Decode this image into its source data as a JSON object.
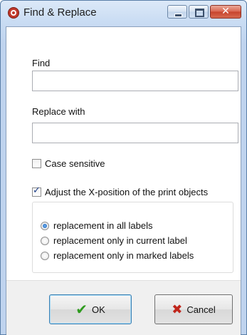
{
  "window": {
    "title": "Find & Replace",
    "close_glyph": "✕"
  },
  "find": {
    "label": "Find",
    "value": "",
    "placeholder": ""
  },
  "replace": {
    "label": "Replace with",
    "value": "",
    "placeholder": ""
  },
  "options": {
    "case_sensitive": {
      "label": "Case sensitive",
      "checked": false
    },
    "adjust_x": {
      "label": "Adjust the X-position of the print objects",
      "checked": true
    }
  },
  "scope": {
    "selected": "all",
    "items": [
      {
        "id": "all",
        "label": "replacement in all labels"
      },
      {
        "id": "current",
        "label": "replacement only in current label"
      },
      {
        "id": "marked",
        "label": "replacement only in marked labels"
      }
    ]
  },
  "buttons": {
    "ok_label": "OK",
    "ok_icon": "check-icon",
    "cancel_label": "Cancel",
    "cancel_icon": "x-icon"
  },
  "colors": {
    "ok_icon": "#2e9b1e",
    "cancel_icon": "#c0261c",
    "close_button": "#c7432b",
    "radio_selected": "#1a5fb4"
  }
}
